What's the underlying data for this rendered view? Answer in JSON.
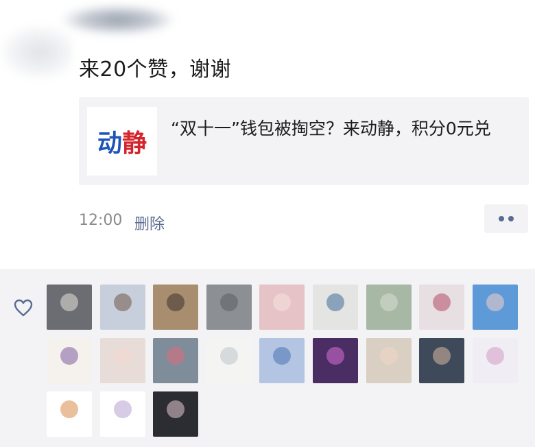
{
  "post": {
    "message": "来20个赞，谢谢"
  },
  "card": {
    "logo_part1": "动",
    "logo_part2": "静",
    "title": "“双十一”钱包被掏空？来动静，积分0元兑"
  },
  "meta": {
    "time": "12:00",
    "delete_label": "删除"
  },
  "likes": {
    "icon": "heart-outline-icon",
    "avatars": [
      {
        "bg": "#6b6d72",
        "face": "#e8e2dc"
      },
      {
        "bg": "#c8cfdc",
        "face": "#6f5a4a"
      },
      {
        "bg": "#a88d6e",
        "face": "#3c3530"
      },
      {
        "bg": "#8c8f93",
        "face": "#5b5e62"
      },
      {
        "bg": "#e6c3c7",
        "face": "#f4e1dc"
      },
      {
        "bg": "#e4e4e2",
        "face": "#3f6d9a"
      },
      {
        "bg": "#a7b8a4",
        "face": "#d9ddd6"
      },
      {
        "bg": "#e8dfe2",
        "face": "#b34b68"
      },
      {
        "bg": "#5f9ad8",
        "face": "#f0d2c6"
      },
      {
        "bg": "#f5f2ee",
        "face": "#7e5c9f"
      },
      {
        "bg": "#e8dcd8",
        "face": "#f3d8d0"
      },
      {
        "bg": "#7e8d99",
        "face": "#e26c7d"
      },
      {
        "bg": "#f4f4f2",
        "face": "#bfc4cb"
      },
      {
        "bg": "#b3c5e3",
        "face": "#4873b3"
      },
      {
        "bg": "#4a2e63",
        "face": "#d86fd3"
      },
      {
        "bg": "#d9cfc3",
        "face": "#f2d7c3"
      },
      {
        "bg": "#3e4a59",
        "face": "#d8b8a0"
      },
      {
        "bg": "#f0eef4",
        "face": "#d39ac4"
      },
      {
        "bg": "#ffffff",
        "face": "#d98c4a"
      },
      {
        "bg": "#ffffff",
        "face": "#b7a0cf"
      },
      {
        "bg": "#2b2d33",
        "face": "#e6c8cf"
      }
    ]
  }
}
